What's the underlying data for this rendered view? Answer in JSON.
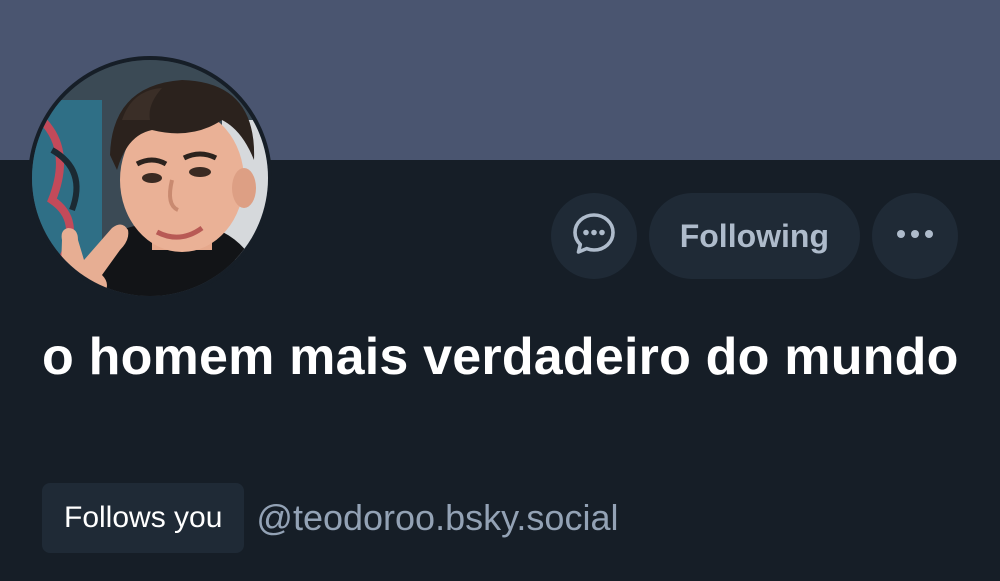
{
  "profile": {
    "display_name": "o homem mais verdadeiro do mundo",
    "handle": "@teodoroo.bsky.social",
    "follows_you_label": "Follows you",
    "avatar": "profile-photo"
  },
  "actions": {
    "message_icon": "message-bubble-icon",
    "following_label": "Following",
    "more_icon": "more-dots-icon"
  },
  "colors": {
    "banner": "#4a5570",
    "background": "#161e27",
    "button_bg": "#1f2a36",
    "button_text": "#aebbcb",
    "handle_text": "#93a2b5"
  }
}
